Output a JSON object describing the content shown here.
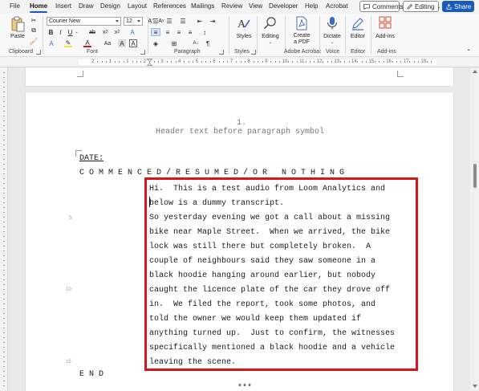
{
  "menu": {
    "tabs": [
      "File",
      "Home",
      "Insert",
      "Draw",
      "Design",
      "Layout",
      "References",
      "Mailings",
      "Review",
      "View",
      "Developer",
      "Help",
      "Acrobat"
    ],
    "active_tab": "Home",
    "comments_label": "Comments",
    "editing_label": "Editing",
    "share_label": "Share"
  },
  "ribbon": {
    "clipboard": {
      "paste_label": "Paste",
      "group_label": "Clipboard"
    },
    "font": {
      "font_name": "Courier New",
      "font_size": "12",
      "group_label": "Font"
    },
    "paragraph": {
      "group_label": "Paragraph"
    },
    "styles": {
      "styles_label": "Styles",
      "group_label": "Styles"
    },
    "editing": {
      "editing_label": "Editing"
    },
    "adobe": {
      "create_pdf_label_1": "Create",
      "create_pdf_label_2": "a PDF",
      "group_label": "Adobe Acrobat"
    },
    "voice": {
      "dictate_label": "Dictate",
      "group_label": "Voice"
    },
    "editor": {
      "editor_label": "Editor",
      "group_label": "Editor"
    },
    "addins": {
      "addins_label": "Add-ins",
      "group_label": "Add-ins"
    }
  },
  "ruler": {
    "numbers": [
      "2",
      "1",
      "1",
      "2",
      "3",
      "4",
      "5",
      "6",
      "7",
      "8",
      "9",
      "10",
      "11",
      "12",
      "13",
      "14",
      "15",
      "16",
      "17",
      "18"
    ]
  },
  "document": {
    "page_number": "1.",
    "header_text": "Header text before paragraph symbol",
    "date_label": "DATE:",
    "commenced_line": "C O M M E N C E D / R E S U M E D / O R   N O T H I N G",
    "transcript_lines": [
      "Hi.  This is a test audio from Loom Analytics and",
      "below is a dummy transcript.",
      "So yesterday evening we got a call about a missing",
      "bike near Maple Street.  When we arrived, the bike",
      "lock was still there but completely broken.  A",
      "couple of neighbours said they saw someone in a",
      "black hoodie hanging around earlier, but nobody",
      "caught the licence plate of the car they drove off",
      "in.  We filed the report, took some photos, and",
      "told the owner we would keep them updated if",
      "anything turned up.  Just to confirm, the witnesses",
      "specifically mentioned a black hoodie and a vehicle",
      "leaving the scene."
    ],
    "line_numbers": [
      "5",
      "10",
      "15"
    ],
    "end_label": "E N D",
    "stars": "***"
  },
  "colors": {
    "accent": "#185abd",
    "highlight_box": "#d9141b"
  }
}
